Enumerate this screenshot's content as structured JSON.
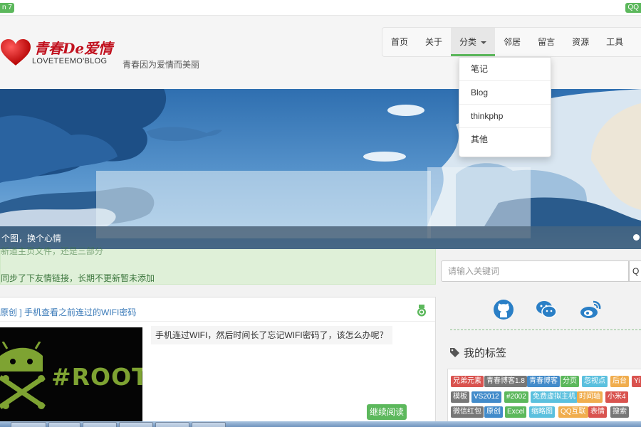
{
  "topbar": {
    "left_badge": "n 7",
    "right_badge": "QQ"
  },
  "site": {
    "logo_cn": "青春De爱情",
    "logo_en": "LOVETEEMO'BLOG",
    "slogan": "青春因为爱情而美丽"
  },
  "nav": {
    "items": [
      "首页",
      "关于",
      "分类",
      "邻居",
      "留言",
      "资源",
      "工具"
    ],
    "active_index": 2
  },
  "dropdown": {
    "items": [
      "笔记",
      "Blog",
      "thinkphp",
      "其他"
    ]
  },
  "banner": {
    "caption": "个图，换个心情"
  },
  "notice": {
    "line1": "同步了下友情链接，长期不更新暂未添加",
    "partial_line": "新道主页文件，还是三部分"
  },
  "article": {
    "title": "原创 ] 手机查看之前连过的WIFI密码",
    "summary": "手机连过WIFI，然后时间长了忘记WIFI密码了，该怎么办呢？",
    "thumb_text": "#ROOT",
    "read_more": "继续阅读"
  },
  "search": {
    "placeholder": "请输入关键词",
    "button": "Q"
  },
  "social": {
    "icons": [
      "github-icon",
      "wechat-icon",
      "weibo-icon"
    ]
  },
  "tags": {
    "title": "我的标签",
    "items": [
      {
        "label": "兄弟元素",
        "color": "#d9534f"
      },
      {
        "label": "青春博客1.8",
        "color": "#777777"
      },
      {
        "label": "青春博客",
        "color": "#428bca"
      },
      {
        "label": "分页",
        "color": "#5cb85c"
      },
      {
        "label": "忽视点",
        "color": "#5bc0de"
      },
      {
        "label": "后台",
        "color": "#f0ad4e"
      },
      {
        "label": "Yi",
        "color": "#d9534f"
      },
      {
        "label": "模板",
        "color": "#777777"
      },
      {
        "label": "VS2012",
        "color": "#428bca"
      },
      {
        "label": "#2002",
        "color": "#5cb85c"
      },
      {
        "label": "免费虚拟主机",
        "color": "#5bc0de"
      },
      {
        "label": "时间轴",
        "color": "#f0ad4e"
      },
      {
        "label": "小米4",
        "color": "#d9534f"
      },
      {
        "label": "微信红包",
        "color": "#777777"
      },
      {
        "label": "原创",
        "color": "#428bca"
      },
      {
        "label": "Excel",
        "color": "#5cb85c"
      },
      {
        "label": "缩略图",
        "color": "#5bc0de"
      },
      {
        "label": "QQ互联",
        "color": "#f0ad4e"
      },
      {
        "label": "表情",
        "color": "#d9534f"
      },
      {
        "label": "搜索",
        "color": "#777777"
      }
    ]
  },
  "colors": {
    "accent_green": "#5cb85c",
    "logo_red": "#c1121f",
    "link_blue": "#3a7ab8",
    "notice_bg": "#dff0d8"
  }
}
